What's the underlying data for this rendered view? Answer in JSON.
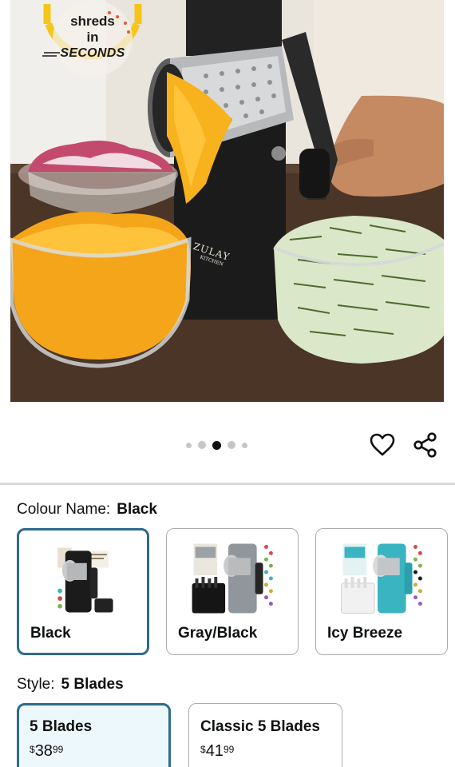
{
  "badge": {
    "line1": "shreds",
    "line2": "in",
    "line3": "SECONDS",
    "ring_color": "#f5c518"
  },
  "product_image": {
    "brand_name": "ZULAY",
    "brand_sub": "KITCHEN"
  },
  "carousel": {
    "total_images": 5,
    "active_index": 2
  },
  "actions": {
    "wishlist_icon": "heart-icon",
    "share_icon": "share-icon"
  },
  "colour": {
    "label": "Colour Name:",
    "selected": "Black",
    "options": [
      {
        "label": "Black",
        "selected": true,
        "body_color": "#1b1b1b"
      },
      {
        "label": "Gray/Black",
        "selected": false,
        "body_color": "#8f969c"
      },
      {
        "label": "Icy Breeze",
        "selected": false,
        "body_color": "#3bb4c1"
      }
    ]
  },
  "style": {
    "label": "Style:",
    "selected": "5 Blades",
    "options": [
      {
        "label": "5 Blades",
        "price_symbol": "$",
        "price_whole": "38",
        "price_fraction": "99",
        "selected": true
      },
      {
        "label": "Classic 5 Blades",
        "price_symbol": "$",
        "price_whole": "41",
        "price_fraction": "99",
        "selected": false
      }
    ]
  },
  "colors": {
    "selected_border": "#2e6b8c",
    "selected_bg": "#edf8fd",
    "divider": "#d5d9d9"
  }
}
